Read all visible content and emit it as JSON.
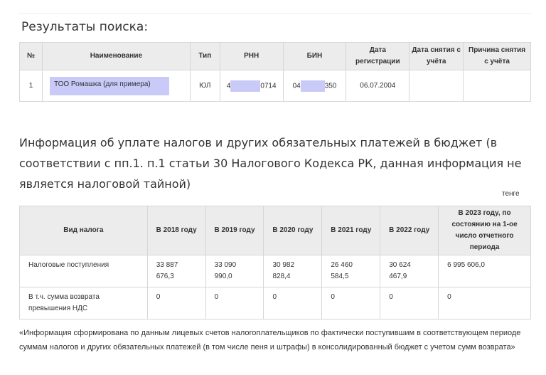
{
  "search": {
    "heading": "Результаты поиска:",
    "headers": [
      "№",
      "Наименование",
      "Тип",
      "РНН",
      "БИН",
      "Дата регистрации",
      "Дата снятия с учёта",
      "Причина снятия с учёта"
    ],
    "row": {
      "num": "1",
      "name": "ТОО Ромашка (для примера)",
      "type": "ЮЛ",
      "rnn_start": "4",
      "rnn_end": "0714",
      "bin_start": "04",
      "bin_end": "350",
      "reg_date": "06.07.2004",
      "dereg_date": "",
      "dereg_reason": ""
    }
  },
  "taxes": {
    "heading": "Информация об уплате налогов и других обязательных платежей в бюджет (в соответствии с пп.1. п.1 статьи 30 Налогового Кодекса РК, данная информация не является налоговой тайной)",
    "currency": "тенге",
    "headers": [
      "Вид налога",
      "В 2018 году",
      "В 2019 году",
      "В 2020 году",
      "В 2021 году",
      "В 2022 году",
      "В 2023 году, по состоянию на 1-ое число отчетного периода"
    ],
    "rows": [
      {
        "name": "Налоговые поступления",
        "values": [
          [
            "33 887",
            "676,3"
          ],
          [
            "33 090",
            "990,0"
          ],
          [
            "30 982",
            "828,4"
          ],
          [
            "26 460",
            "584,5"
          ],
          [
            "30 624",
            "467,9"
          ],
          [
            "6 995 606,0",
            ""
          ]
        ]
      },
      {
        "name": "В т.ч. сумма возврата превышения НДС",
        "values": [
          [
            "0",
            ""
          ],
          [
            "0",
            ""
          ],
          [
            "0",
            ""
          ],
          [
            "0",
            ""
          ],
          [
            "0",
            ""
          ],
          [
            "0",
            ""
          ]
        ]
      }
    ]
  },
  "footnote": "«Информация сформирована по данным лицевых счетов налогоплательщиков по фактически поступившим в соответствующем периоде суммам налогов и других обязательных платежей (в том числе пеня и штрафы) в консолидированный бюджет с учетом сумм возврата»",
  "colors": {
    "header_bg": "#ececec",
    "border": "#d6d6d6",
    "highlight": "#c9caf8",
    "text": "#333333"
  }
}
